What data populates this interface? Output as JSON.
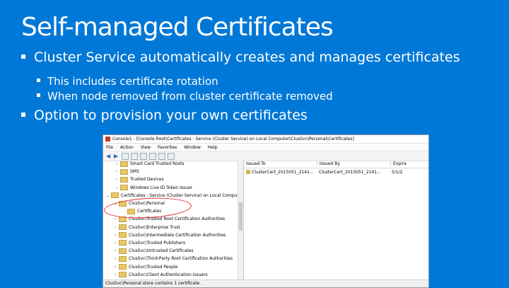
{
  "slide": {
    "title": "Self-managed Certificates",
    "bullets": [
      {
        "level": 1,
        "text": "Cluster Service automatically creates and manages certificates"
      },
      {
        "level": 2,
        "text": "This includes certificate rotation"
      },
      {
        "level": 2,
        "text": "When node removed from cluster certificate removed"
      },
      {
        "level": 1,
        "text": "Option to provision your own certificates"
      }
    ]
  },
  "window": {
    "title": "Console1 - [Console Root\\Certificates - Service (Cluster Service) on Local Computer\\ClusSvc\\Personal\\Certificates]",
    "menu": [
      "File",
      "Action",
      "View",
      "Favorites",
      "Window",
      "Help"
    ],
    "tree": [
      {
        "expander": "›",
        "label": "Smart Card Trusted Roots"
      },
      {
        "expander": "›",
        "label": "SMS"
      },
      {
        "expander": "›",
        "label": "Trusted Devices"
      },
      {
        "expander": "›",
        "label": "Windows Live ID Token Issuer"
      },
      {
        "expander": "⌄",
        "label": "Certificates - Service (Cluster Service) on Local Computer"
      },
      {
        "expander": "⌄",
        "label": "ClusSvc\\Personal"
      },
      {
        "expander": "",
        "label": "Certificates"
      },
      {
        "expander": "›",
        "label": "ClusSvc\\Trusted Root Certification Authorities"
      },
      {
        "expander": "›",
        "label": "ClusSvc\\Enterprise Trust"
      },
      {
        "expander": "›",
        "label": "ClusSvc\\Intermediate Certification Authorities"
      },
      {
        "expander": "›",
        "label": "ClusSvc\\Trusted Publishers"
      },
      {
        "expander": "›",
        "label": "ClusSvc\\Untrusted Certificates"
      },
      {
        "expander": "›",
        "label": "ClusSvc\\Third-Party Root Certification Authorities"
      },
      {
        "expander": "›",
        "label": "ClusSvc\\Trusted People"
      },
      {
        "expander": "›",
        "label": "ClusSvc\\Client Authentication Issuers"
      }
    ],
    "columns": [
      "Issued To",
      "Issued By",
      "Expira"
    ],
    "rows": [
      {
        "issued_to": "ClusterCert_2015051_2141...",
        "issued_by": "ClusterCert_2015051_2141...",
        "expires": "5/1/2"
      }
    ],
    "status": "ClusSvc\\Personal store contains 1 certificate."
  }
}
